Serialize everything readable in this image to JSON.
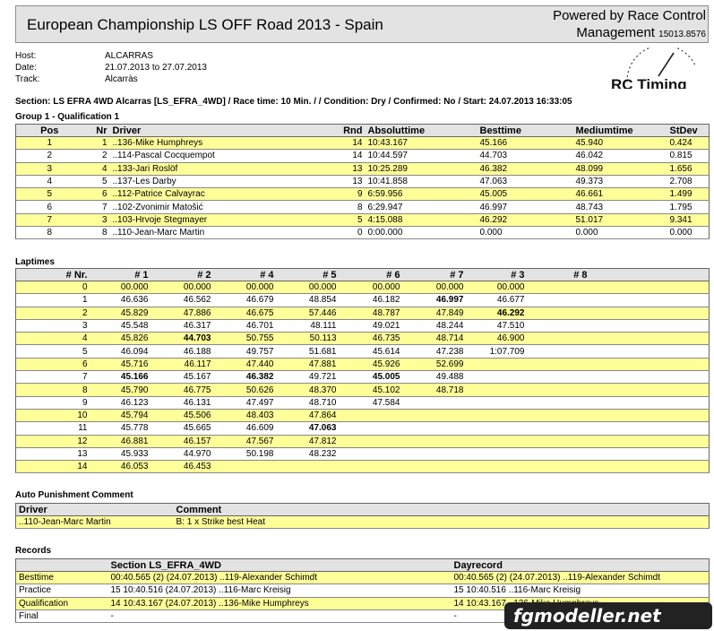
{
  "header": {
    "title": "European Championship LS OFF Road 2013 - Spain",
    "powered_line1": "Powered by Race Control",
    "powered_line2": "Management",
    "code": "15013.8576"
  },
  "meta": {
    "host_label": "Host:",
    "host": "ALCARRAS",
    "date_label": "Date:",
    "date": "21.07.2013 to 27.07.2013",
    "track_label": "Track:",
    "track": "Alcarràs"
  },
  "logo": {
    "text": "RC Timing"
  },
  "section_line": "Section: LS EFRA 4WD Alcarras [LS_EFRA_4WD] / Race time: 10 Min. / / Condition: Dry / Confirmed: No / Start: 24.07.2013 16:33:05",
  "group_title": "Group 1 - Qualification 1",
  "qualification": {
    "headers": [
      "Pos",
      "Nr",
      "Driver",
      "Rnd",
      "Absoluttime",
      "Besttime",
      "Mediumtime",
      "StDev"
    ],
    "rows": [
      [
        "1",
        "1",
        "..136-Mike Humphreys",
        "14",
        "10:43.167",
        "45.166",
        "45.940",
        "0.424"
      ],
      [
        "2",
        "2",
        "..114-Pascal Cocquempot",
        "14",
        "10:44.597",
        "44.703",
        "46.042",
        "0.815"
      ],
      [
        "3",
        "4",
        "..133-Jari Roslöf",
        "13",
        "10:25.289",
        "46.382",
        "48.099",
        "1.656"
      ],
      [
        "4",
        "5",
        "..137-Les Darby",
        "13",
        "10:41.858",
        "47.063",
        "49.373",
        "2.708"
      ],
      [
        "5",
        "6",
        "..112-Patrice Calvayrac",
        "9",
        "6:59.956",
        "45.005",
        "46.661",
        "1.499"
      ],
      [
        "6",
        "7",
        "..102-Zvonimir Matošić",
        "8",
        "6:29.947",
        "46.997",
        "48.743",
        "1.795"
      ],
      [
        "7",
        "3",
        "..103-Hrvoje Stegmayer",
        "5",
        "4:15.088",
        "46.292",
        "51.017",
        "9.341"
      ],
      [
        "8",
        "8",
        "..110-Jean-Marc Martin",
        "0",
        "0:00.000",
        "0.000",
        "0.000",
        "0.000"
      ]
    ]
  },
  "laptimes_title": "Laptimes",
  "laptimes": {
    "headers": [
      "# Nr.",
      "# 1",
      "# 2",
      "# 4",
      "# 5",
      "# 6",
      "# 7",
      "# 3",
      "# 8"
    ],
    "rows": [
      [
        "0",
        "00.000",
        "00.000",
        "00.000",
        "00.000",
        "00.000",
        "00.000",
        "00.000",
        ""
      ],
      [
        "1",
        "46.636",
        "46.562",
        "46.679",
        "48.854",
        "46.182",
        "46.997",
        "46.677",
        ""
      ],
      [
        "2",
        "45.829",
        "47.886",
        "46.675",
        "57.446",
        "48.787",
        "47.849",
        "46.292",
        ""
      ],
      [
        "3",
        "45.548",
        "46.317",
        "46.701",
        "48.111",
        "49.021",
        "48.244",
        "47.510",
        ""
      ],
      [
        "4",
        "45.826",
        "44.703",
        "50.755",
        "50.113",
        "46.735",
        "48.714",
        "46.900",
        ""
      ],
      [
        "5",
        "46.094",
        "46.188",
        "49.757",
        "51.681",
        "45.614",
        "47.238",
        "1:07.709",
        ""
      ],
      [
        "6",
        "45.716",
        "46.117",
        "47.440",
        "47.881",
        "45.926",
        "52.699",
        "",
        ""
      ],
      [
        "7",
        "45.166",
        "45.167",
        "46.382",
        "49.721",
        "45.005",
        "49.488",
        "",
        ""
      ],
      [
        "8",
        "45.790",
        "46.775",
        "50.626",
        "48.370",
        "45.102",
        "48.718",
        "",
        ""
      ],
      [
        "9",
        "46.123",
        "46.131",
        "47.497",
        "48.710",
        "47.584",
        "",
        "",
        ""
      ],
      [
        "10",
        "45.794",
        "45.506",
        "48.403",
        "47.864",
        "",
        "",
        "",
        ""
      ],
      [
        "11",
        "45.778",
        "45.665",
        "46.609",
        "47.063",
        "",
        "",
        "",
        ""
      ],
      [
        "12",
        "46.881",
        "46.157",
        "47.567",
        "47.812",
        "",
        "",
        "",
        ""
      ],
      [
        "13",
        "45.933",
        "44.970",
        "50.198",
        "48.232",
        "",
        "",
        "",
        ""
      ],
      [
        "14",
        "46.053",
        "46.453",
        "",
        "",
        "",
        "",
        "",
        ""
      ]
    ],
    "best_cells": [
      "1-6",
      "2-7",
      "4-2",
      "7-1",
      "7-3",
      "7-5",
      "11-4"
    ]
  },
  "punishment_title": "Auto Punishment Comment",
  "punishment": {
    "headers": [
      "Driver",
      "Comment"
    ],
    "rows": [
      [
        "..110-Jean-Marc Martin",
        "B: 1 x Strike best Heat"
      ]
    ]
  },
  "records_title": "Records",
  "records": {
    "headers": [
      "",
      "Section LS_EFRA_4WD",
      "Dayrecord"
    ],
    "rows": [
      [
        "Besttime",
        "00:40.565 (2) (24.07.2013) ..119-Alexander Schimdt",
        "00:40.565 (2) (24.07.2013) ..119-Alexander Schimdt"
      ],
      [
        "Practice",
        "15 10:40.516 (24.07.2013) ..116-Marc Kreisig",
        "15 10:40.516 ..116-Marc Kreisig"
      ],
      [
        "Qualification",
        "14 10:43.167 (24.07.2013) ..136-Mike Humphreys",
        "14 10:43.167 ..136-Mike Humphreys"
      ],
      [
        "Final",
        "-",
        "-"
      ]
    ]
  },
  "watermark": "fgmodeller.net"
}
